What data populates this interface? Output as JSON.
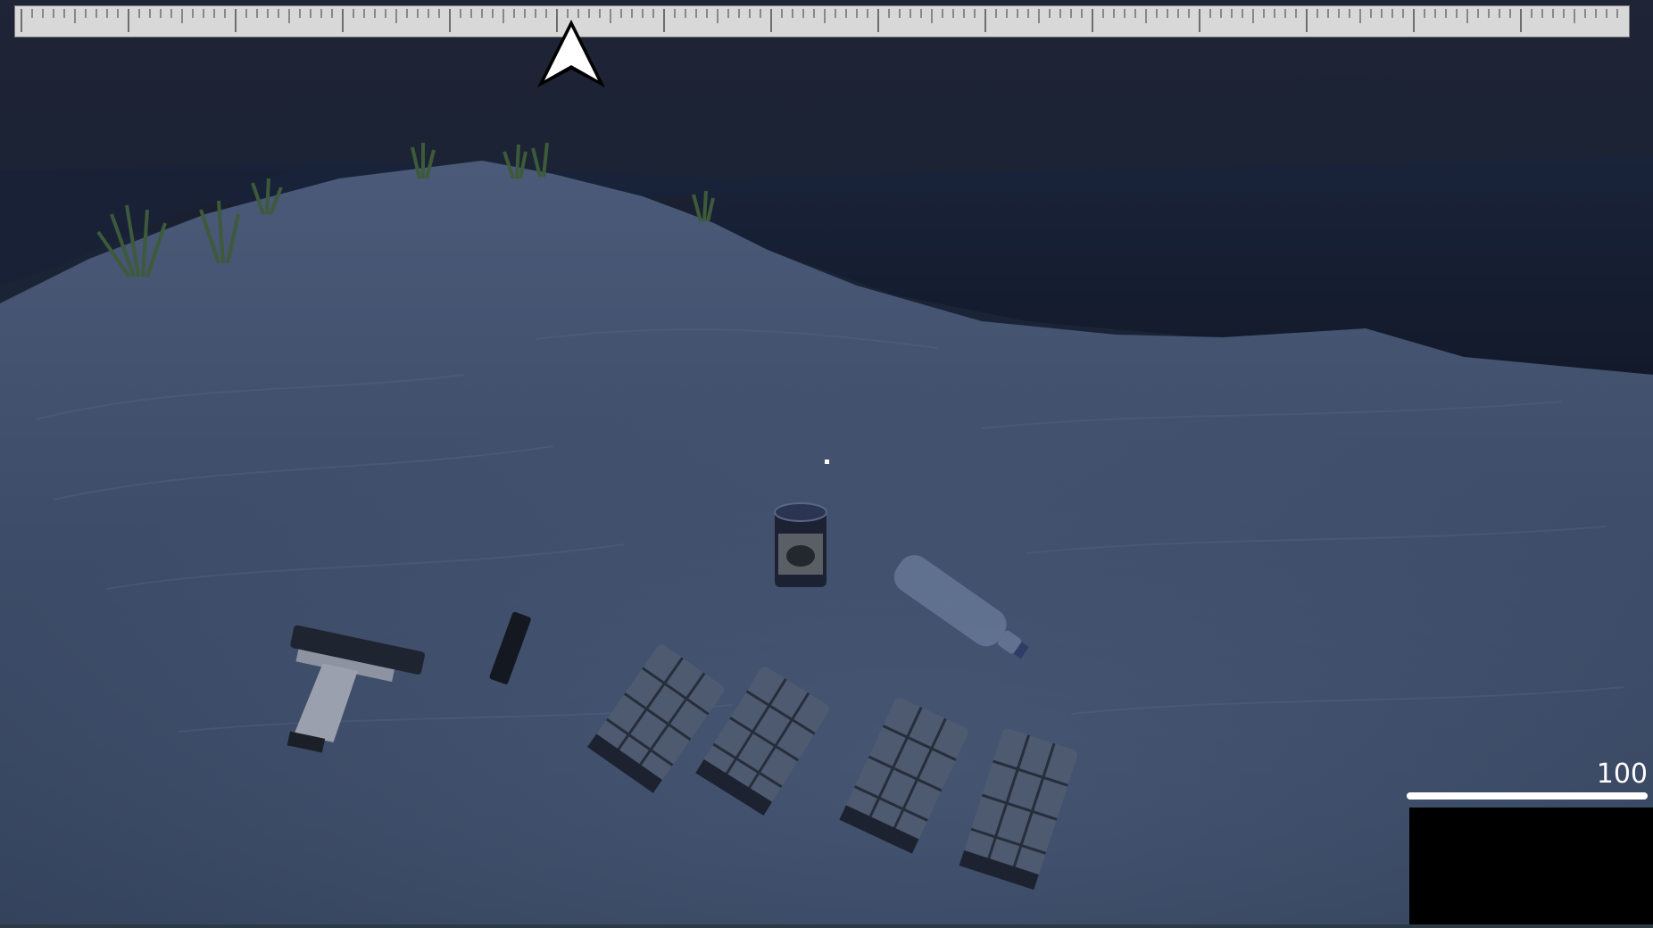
{
  "hud": {
    "health_value": "100",
    "health_fraction": 1.0,
    "compass_icon": "navigation-arrow-icon",
    "crosshair_icon": "crosshair-dot"
  },
  "world": {
    "items": [
      {
        "name": "pistol",
        "icon": "pistol-icon"
      },
      {
        "name": "pistol-magazine",
        "icon": "magazine-icon"
      },
      {
        "name": "canned-food",
        "icon": "can-icon"
      },
      {
        "name": "water-bottle",
        "icon": "bottle-icon"
      },
      {
        "name": "rifle-magazine",
        "icon": "magazine-icon"
      },
      {
        "name": "rifle-magazine",
        "icon": "magazine-icon"
      },
      {
        "name": "rifle-magazine",
        "icon": "magazine-icon"
      },
      {
        "name": "rifle-magazine",
        "icon": "magazine-icon"
      }
    ]
  },
  "colors": {
    "sky": "#1d2333",
    "sand": "#3b4a66",
    "water": "#151d2d",
    "hud_white": "#ffffff",
    "compass_bg": "#d8d8d8"
  }
}
